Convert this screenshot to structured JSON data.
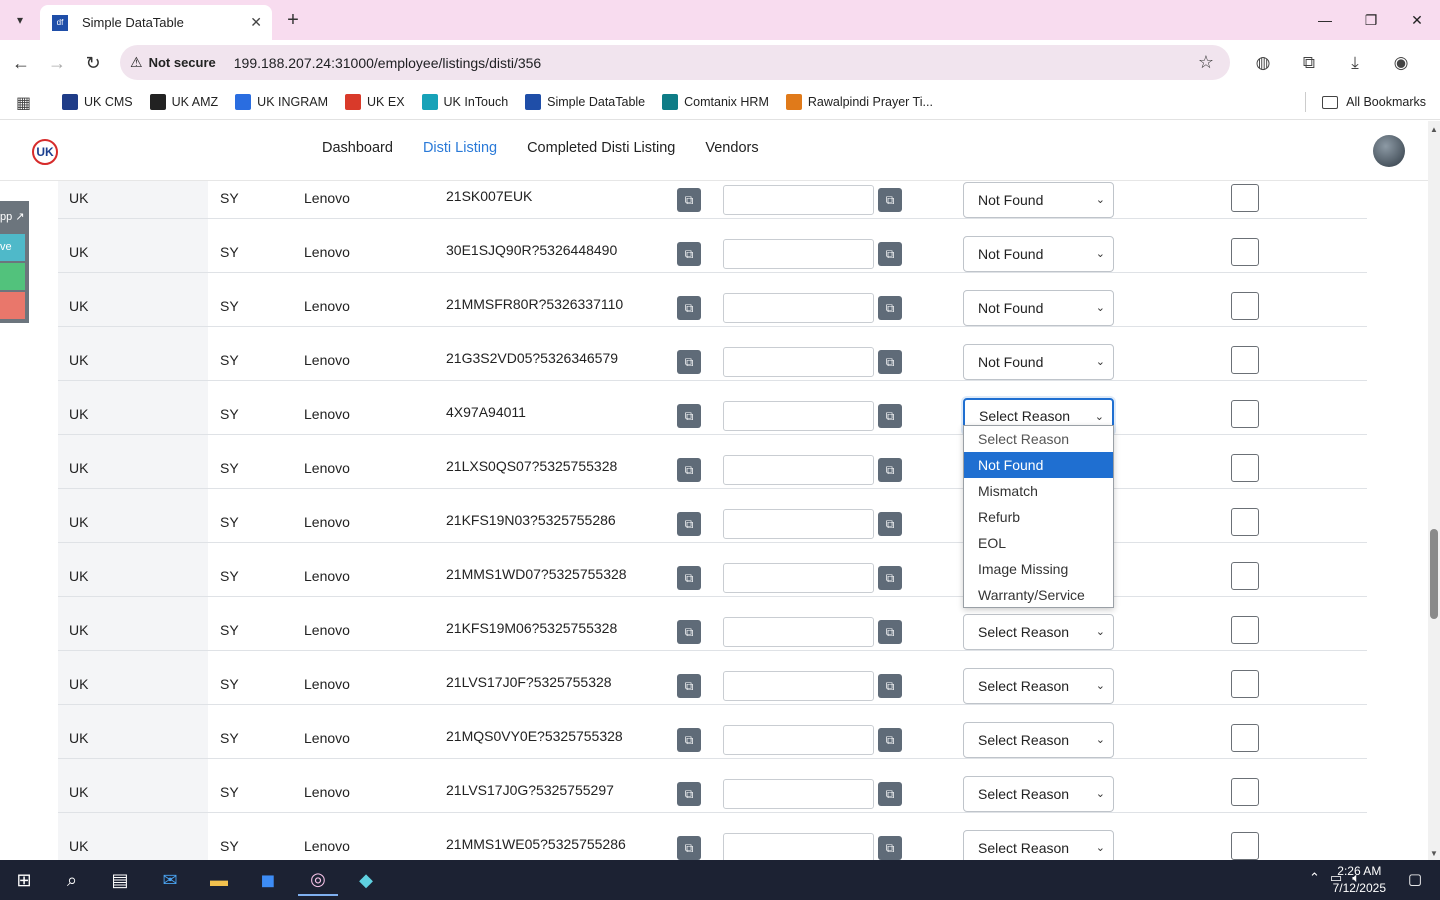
{
  "browser": {
    "tab_title": "Simple DataTable",
    "tab_favicon": "df",
    "not_secure": "Not secure",
    "url": "199.188.207.24:31000/employee/listings/disti/356",
    "bookmarks": [
      {
        "label": "UK CMS",
        "icon": "ukcms-icon",
        "color": "#1f3c88"
      },
      {
        "label": "UK AMZ",
        "icon": "amazon-icon",
        "color": "#222222"
      },
      {
        "label": "UK INGRAM",
        "icon": "ingram-icon",
        "color": "#2a6de0"
      },
      {
        "label": "UK EX",
        "icon": "ex-icon",
        "color": "#d93a2a"
      },
      {
        "label": "UK InTouch",
        "icon": "intouch-icon",
        "color": "#17a2b8"
      },
      {
        "label": "Simple DataTable",
        "icon": "df-icon",
        "color": "#1f4ea8"
      },
      {
        "label": "Comtanix HRM",
        "icon": "comtanix-icon",
        "color": "#0e7c86"
      },
      {
        "label": "Rawalpindi Prayer Ti...",
        "icon": "prayer-icon",
        "color": "#e07a1a"
      }
    ],
    "all_bookmarks": "All Bookmarks"
  },
  "app": {
    "logo": "UK",
    "nav": [
      "Dashboard",
      "Disti Listing",
      "Completed Disti Listing",
      "Vendors"
    ],
    "active_nav": "Disti Listing",
    "side_labels": [
      "pp ↗",
      "ve"
    ]
  },
  "table": {
    "rows": [
      {
        "region": "UK",
        "code": "SY",
        "brand": "Lenovo",
        "sku": "21SK007EUK",
        "reason": "Not Found"
      },
      {
        "region": "UK",
        "code": "SY",
        "brand": "Lenovo",
        "sku": "30E1SJQ90R?5326448490",
        "reason": "Not Found"
      },
      {
        "region": "UK",
        "code": "SY",
        "brand": "Lenovo",
        "sku": "21MMSFR80R?5326337110",
        "reason": "Not Found"
      },
      {
        "region": "UK",
        "code": "SY",
        "brand": "Lenovo",
        "sku": "21G3S2VD05?5326346579",
        "reason": "Not Found"
      },
      {
        "region": "UK",
        "code": "SY",
        "brand": "Lenovo",
        "sku": "4X97A94011",
        "reason": "Select Reason"
      },
      {
        "region": "UK",
        "code": "SY",
        "brand": "Lenovo",
        "sku": "21LXS0QS07?5325755328",
        "reason": "Select Reason"
      },
      {
        "region": "UK",
        "code": "SY",
        "brand": "Lenovo",
        "sku": "21KFS19N03?5325755286",
        "reason": "Select Reason"
      },
      {
        "region": "UK",
        "code": "SY",
        "brand": "Lenovo",
        "sku": "21MMS1WD07?5325755328",
        "reason": "Select Reason"
      },
      {
        "region": "UK",
        "code": "SY",
        "brand": "Lenovo",
        "sku": "21KFS19M06?5325755328",
        "reason": "Select Reason"
      },
      {
        "region": "UK",
        "code": "SY",
        "brand": "Lenovo",
        "sku": "21LVS17J0F?5325755328",
        "reason": "Select Reason"
      },
      {
        "region": "UK",
        "code": "SY",
        "brand": "Lenovo",
        "sku": "21MQS0VY0E?5325755328",
        "reason": "Select Reason"
      },
      {
        "region": "UK",
        "code": "SY",
        "brand": "Lenovo",
        "sku": "21LVS17J0G?5325755297",
        "reason": "Select Reason"
      },
      {
        "region": "UK",
        "code": "SY",
        "brand": "Lenovo",
        "sku": "21MMS1WE05?5325755286",
        "reason": "Select Reason"
      }
    ]
  },
  "dropdown": {
    "options": [
      "Select Reason",
      "Not Found",
      "Mismatch",
      "Refurb",
      "EOL",
      "Image Missing",
      "Warranty/Service"
    ],
    "highlighted": "Not Found"
  },
  "taskbar": {
    "time": "2:26 AM",
    "date": "7/12/2025",
    "notifications": "1"
  }
}
